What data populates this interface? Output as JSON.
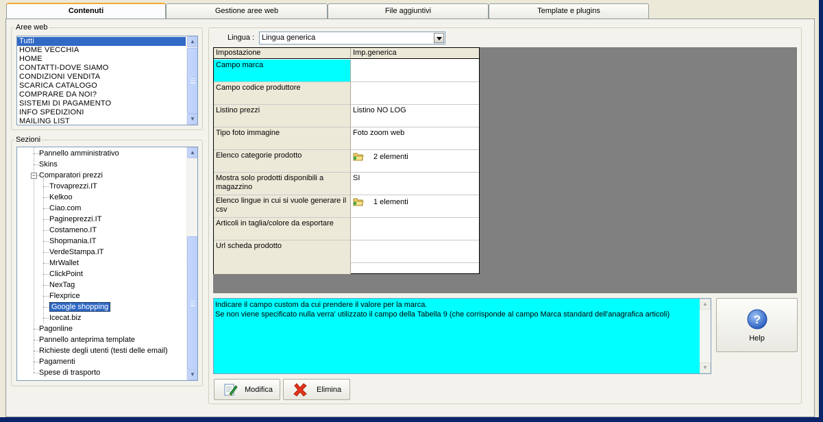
{
  "tabs": [
    {
      "label": "Contenuti",
      "active": true
    },
    {
      "label": "Gestione aree web",
      "active": false
    },
    {
      "label": "File aggiuntivi",
      "active": false
    },
    {
      "label": "Template e plugins",
      "active": false
    }
  ],
  "aree_web": {
    "legend": "Aree web",
    "items": [
      "Tutti",
      "HOME VECCHIA",
      "HOME",
      "CONTATTI-DOVE SIAMO",
      "CONDIZIONI VENDITA",
      "SCARICA CATALOGO",
      "COMPRARE DA NOI?",
      "SISTEMI DI PAGAMENTO",
      "INFO SPEDIZIONI",
      "MAILING LIST"
    ],
    "selected_index": 0
  },
  "sezioni": {
    "legend": "Sezioni",
    "items": [
      {
        "label": "Pannello amministrativo",
        "level": 0
      },
      {
        "label": "Skins",
        "level": 0
      },
      {
        "label": "Comparatori prezzi",
        "level": 0,
        "expander": "−"
      },
      {
        "label": "Trovaprezzi.IT",
        "level": 1
      },
      {
        "label": "Kelkoo",
        "level": 1
      },
      {
        "label": "Ciao.com",
        "level": 1
      },
      {
        "label": "Pagineprezzi.IT",
        "level": 1
      },
      {
        "label": "Costameno.IT",
        "level": 1
      },
      {
        "label": "Shopmania.IT",
        "level": 1
      },
      {
        "label": "VerdeStampa.IT",
        "level": 1
      },
      {
        "label": "MrWallet",
        "level": 1
      },
      {
        "label": "ClickPoint",
        "level": 1
      },
      {
        "label": "NexTag",
        "level": 1
      },
      {
        "label": "Flexprice",
        "level": 1
      },
      {
        "label": "Google shopping",
        "level": 1,
        "selected": true
      },
      {
        "label": "Icecat.biz",
        "level": 1
      },
      {
        "label": "Pagonline",
        "level": 0
      },
      {
        "label": "Pannello anteprima template",
        "level": 0
      },
      {
        "label": "Richieste degli utenti (testi delle email)",
        "level": 0
      },
      {
        "label": "Pagamenti",
        "level": 0
      },
      {
        "label": "Spese di trasporto",
        "level": 0
      }
    ]
  },
  "lingua": {
    "label": "Lingua :",
    "value": "Lingua generica"
  },
  "grid": {
    "headers": [
      "Impostazione",
      "Imp.generica"
    ],
    "rows": [
      {
        "key": "Campo marca",
        "value": "",
        "active": true
      },
      {
        "key": "Campo codice produttore",
        "value": ""
      },
      {
        "key": "Listino prezzi",
        "value": "Listino NO LOG"
      },
      {
        "key": "Tipo foto immagine",
        "value": "Foto zoom web"
      },
      {
        "key": "Elenco categorie prodotto",
        "value": "2 elementi",
        "icon": "folder-icon"
      },
      {
        "key": "Mostra solo prodotti disponibili a magazzino",
        "value": "SI"
      },
      {
        "key": "Elenco lingue in cui si vuole generare il csv",
        "value": "1 elementi",
        "icon": "folder-icon"
      },
      {
        "key": "Articoli in taglia/colore da esportare",
        "value": ""
      },
      {
        "key": "Url scheda prodotto",
        "value": ""
      }
    ]
  },
  "info": {
    "line1": "Indicare il campo custom da cui prendere il valore per la marca.",
    "line2": "Se non viene specificato nulla verra' utilizzato il campo della Tabella 9 (che corrisponde al campo Marca standard dell'anagrafica articoli)"
  },
  "buttons": {
    "modifica": "Modifica",
    "elimina": "Elimina",
    "help": "Help"
  },
  "colors": {
    "accent": "#00ffff",
    "selection": "#316ac5",
    "window": "#ece9d8"
  }
}
